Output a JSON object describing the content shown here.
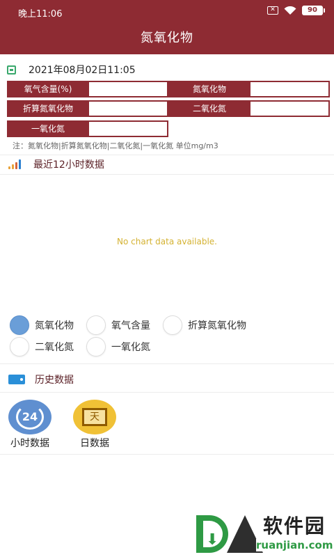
{
  "status": {
    "time": "晚上11:06",
    "battery": "90",
    "sim_icon": "x",
    "wifi_icon": "wifi"
  },
  "app": {
    "title": "氮氧化物"
  },
  "date": {
    "text": "2021年08月02日11:05"
  },
  "readings": [
    {
      "label": "氧气含量(%)",
      "value": ""
    },
    {
      "label": "氮氧化物",
      "value": ""
    },
    {
      "label": "折算氮氧化物",
      "value": ""
    },
    {
      "label": "二氧化氮",
      "value": ""
    },
    {
      "label": "一氧化氮",
      "value": ""
    }
  ],
  "note": "注：氮氧化物|折算氮氧化物|二氧化氮|一氧化氮 单位mg/m3",
  "chart_section": {
    "title": "最近12小时数据",
    "empty_text": "No chart data available."
  },
  "chart_data": {
    "type": "line",
    "series": []
  },
  "radio": {
    "selected_index": 0,
    "options": [
      "氮氧化物",
      "氧气含量",
      "折算氮氧化物",
      "二氧化氮",
      "一氧化氮"
    ]
  },
  "history": {
    "title": "历史数据",
    "tiles": [
      {
        "label": "小时数据",
        "badge": "24",
        "icon": "hour-recycle-icon"
      },
      {
        "label": "日数据",
        "badge": "天",
        "icon": "calendar-day-icon"
      }
    ]
  },
  "watermark": {
    "brand": "软件园",
    "url": "ruanjian.com"
  }
}
